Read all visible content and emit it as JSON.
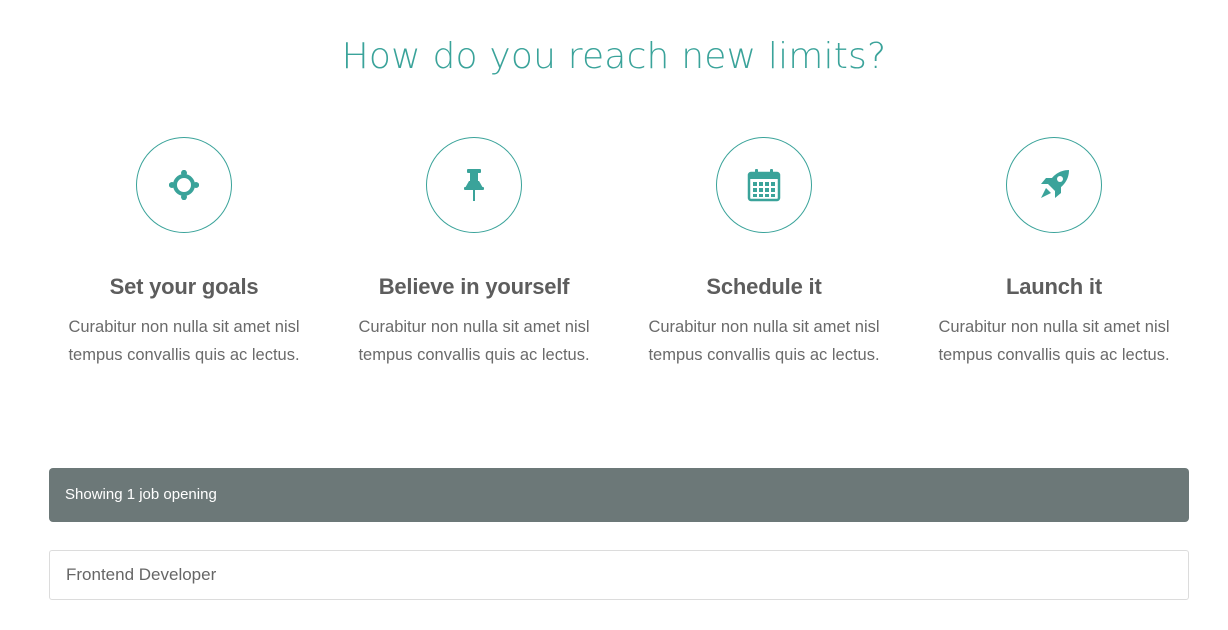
{
  "headline": "How do you reach new limits?",
  "accent_color": "#3aa39a",
  "features": [
    {
      "icon": "crosshair-target-icon",
      "title": "Set your goals",
      "text": "Curabitur non nulla sit amet nisl tempus convallis quis ac lectus."
    },
    {
      "icon": "pushpin-icon",
      "title": "Believe in yourself",
      "text": "Curabitur non nulla sit amet nisl tempus convallis quis ac lectus."
    },
    {
      "icon": "calendar-icon",
      "title": "Schedule it",
      "text": "Curabitur non nulla sit amet nisl tempus convallis quis ac lectus."
    },
    {
      "icon": "rocket-icon",
      "title": "Launch it",
      "text": "Curabitur non nulla sit amet nisl tempus convallis quis ac lectus."
    }
  ],
  "jobs": {
    "summary": "Showing 1 job opening",
    "bar_color": "#6c7878",
    "openings": [
      {
        "title": "Frontend Developer"
      }
    ]
  }
}
